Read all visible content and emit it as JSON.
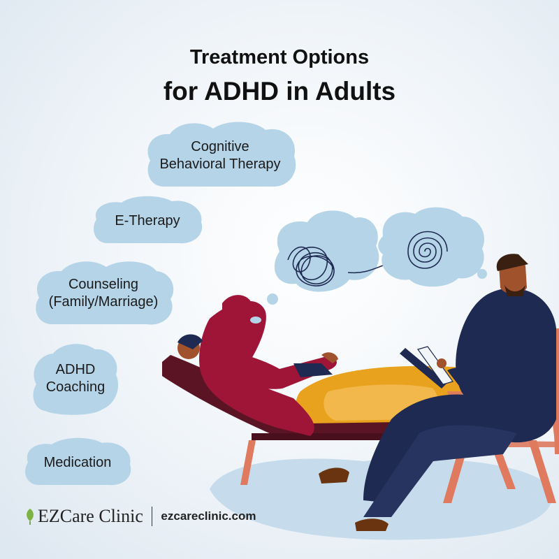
{
  "heading": {
    "line1": "Treatment Options",
    "line2": "for ADHD in Adults"
  },
  "treatments": [
    "Cognitive\nBehavioral Therapy",
    "E-Therapy",
    "Counseling\n(Family/Marriage)",
    "ADHD\nCoaching",
    "Medication"
  ],
  "footer": {
    "brand_name": "EZCare Clinic",
    "url": "ezcareclinic.com"
  },
  "colors": {
    "bubble": "#b5d4e8",
    "patient_suit": "#9e1538",
    "cushion": "#e8a21e",
    "couch_frame": "#5a1424",
    "therapist_suit": "#1f2a52",
    "chair_frame": "#e07a5f",
    "shadow": "#c6dcec"
  },
  "icons": [
    "leaf-icon",
    "scribble-thought-icon",
    "spiral-thought-icon"
  ]
}
